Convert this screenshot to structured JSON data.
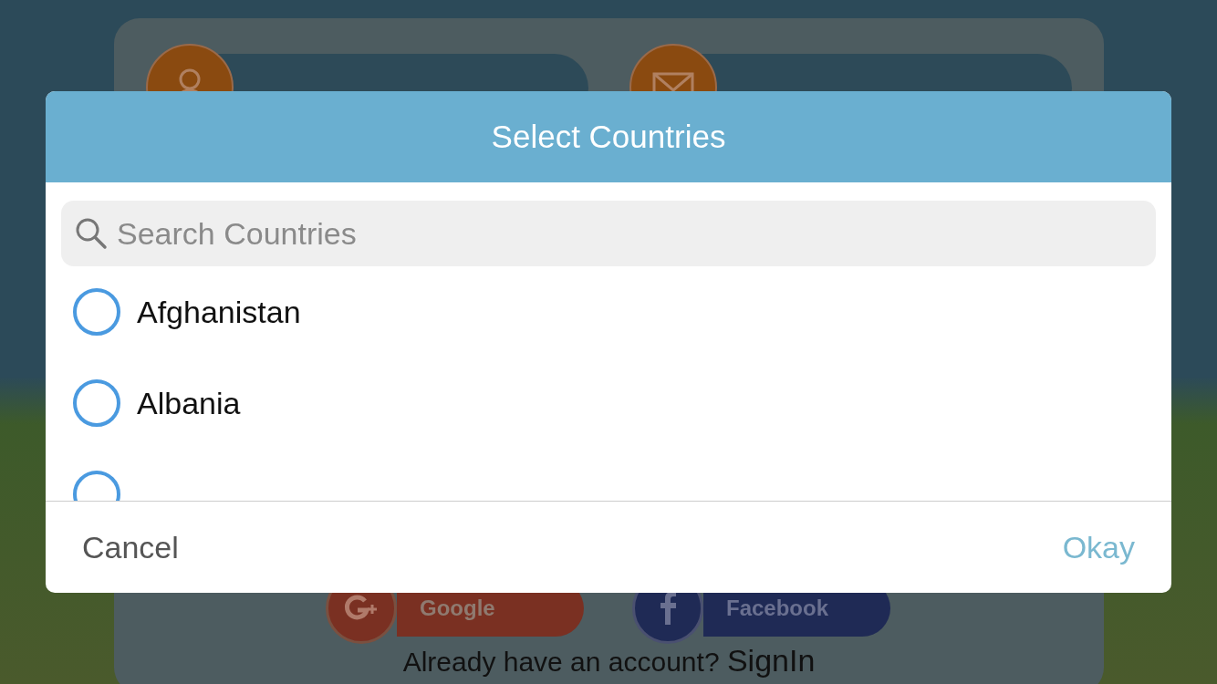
{
  "background_form": {
    "fields": [
      {
        "kind": "user"
      },
      {
        "kind": "mail"
      }
    ],
    "social_buttons": [
      {
        "kind": "google",
        "label": "Google"
      },
      {
        "kind": "facebook",
        "label": "Facebook"
      }
    ],
    "signin_prompt": "Already have an account?",
    "signin_link": "SignIn"
  },
  "dialog": {
    "title": "Select Countries",
    "search": {
      "placeholder": "Search Countries"
    },
    "options": [
      {
        "label": "Afghanistan",
        "selected": false
      },
      {
        "label": "Albania",
        "selected": false
      },
      {
        "selected": false
      }
    ],
    "buttons": [
      {
        "kind": "cancel",
        "label": "Cancel"
      },
      {
        "kind": "okay",
        "label": "Okay"
      }
    ]
  }
}
